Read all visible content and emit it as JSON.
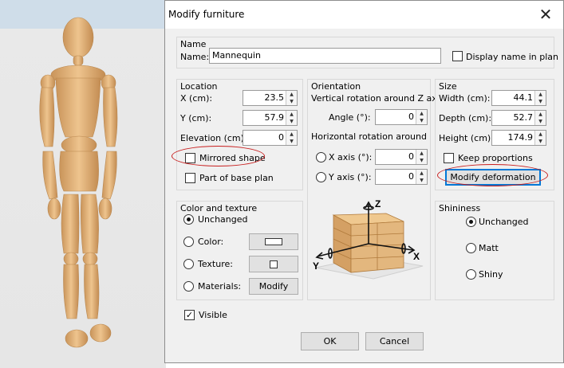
{
  "dialog": {
    "title": "Modify furniture",
    "name_group": {
      "title": "Name",
      "name_label": "Name:",
      "name_value": "Mannequin",
      "display_name_label": "Display name in plan"
    },
    "location": {
      "title": "Location",
      "x_label": "X (cm):",
      "x_value": "23.5",
      "y_label": "Y (cm):",
      "y_value": "57.9",
      "elevation_label": "Elevation (cm):",
      "elevation_value": "0",
      "mirrored_label": "Mirrored shape",
      "base_plan_label": "Part of base plan"
    },
    "orientation": {
      "title": "Orientation",
      "vertical_label": "Vertical rotation around Z axis",
      "angle_label": "Angle (°):",
      "angle_value": "0",
      "horizontal_label": "Horizontal rotation around",
      "x_axis_label": "X axis (°):",
      "x_axis_value": "0",
      "y_axis_label": "Y axis (°):",
      "y_axis_value": "0",
      "axis_z": "Z",
      "axis_x": "X",
      "axis_y": "Y"
    },
    "size": {
      "title": "Size",
      "width_label": "Width (cm):",
      "width_value": "44.1",
      "depth_label": "Depth (cm):",
      "depth_value": "52.7",
      "height_label": "Height (cm):",
      "height_value": "174.9",
      "keep_label": "Keep proportions",
      "deform_button": "Modify deformation"
    },
    "color_texture": {
      "title": "Color and texture",
      "unchanged_label": "Unchanged",
      "color_label": "Color:",
      "texture_label": "Texture:",
      "materials_label": "Materials:",
      "modify_button": "Modify"
    },
    "shininess": {
      "title": "Shininess",
      "unchanged_label": "Unchanged",
      "matt_label": "Matt",
      "shiny_label": "Shiny"
    },
    "visible_label": "Visible",
    "ok_button": "OK",
    "cancel_button": "Cancel"
  },
  "icons": {
    "close": "close-icon",
    "mannequin": "mannequin-3d-model",
    "dresser": "dresser-rotation-illustration"
  },
  "colors": {
    "highlight_ellipse": "#c81e1e",
    "focus_border": "#0078d7",
    "wood": "#e3b77e"
  }
}
